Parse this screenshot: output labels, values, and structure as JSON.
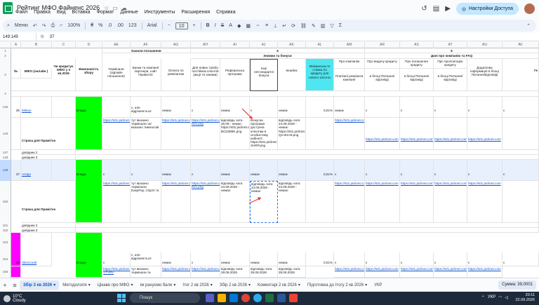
{
  "window": {
    "title": "Рейтинг МФО Файненс 2026",
    "menu": [
      "Файл",
      "Правка",
      "Вид",
      "Вставка",
      "Формат",
      "Данные",
      "Инструменты",
      "Расширения",
      "Справка"
    ],
    "share_label": "Настройки Доступа"
  },
  "toolbar": {
    "menu_label": "Меню",
    "zoom": "100%",
    "currency": "₴",
    "percent": "%",
    "decimals_less": ".0",
    "decimals_more": ".00",
    "number_format": "123",
    "font": "Arial",
    "font_size": "10"
  },
  "formula": {
    "namebox": "149:149",
    "fx": "fx",
    "value": "37"
  },
  "columns": [
    "",
    "A",
    "B",
    "C",
    "D",
    "AE",
    "AF",
    "AG",
    "AH",
    "AI",
    "AJ",
    "AK",
    "AL",
    "AM",
    "AR",
    "AS",
    "AT",
    "AU",
    "AV"
  ],
  "groups": {
    "g1": "Канали погашення",
    "g2": "Знижки та бонуси",
    "g3": "Дані про компанію та FAQ",
    "n5": "5",
    "n6": "6"
  },
  "headers": {
    "num": "№",
    "mfo": "МФО (онлайн )",
    "credits": "Чи кредитує МФО у 3 кв.2026",
    "reqs": "Виконаність зборy",
    "terminals": "Термінали (офлайн погашення)",
    "banks": "Банки та компанії партнери, сайт Приват24",
    "req_pay": "Оплата по реквізитам",
    "new_clients": "Для нових та/або постійних клієнтів (акції та знижки)",
    "referral": "Реферальна програма",
    "other_bonus": "Інші нестандартні бонуси",
    "cashback": "Кешбек",
    "min_rate": "Мінімальна % ставка по кредиту для нового клієнта",
    "about": "Про компанію",
    "payment_req": "Платіжні реквізити компанії",
    "issue": "Про видачу кредиту",
    "repay": "Про погашення кредиту",
    "extend": "Про пролонгацію кредиту",
    "extra": "Додаткова інформація в блоці Питання/відповіді",
    "in_block1": "в блоці Питання/відповіді",
    "in_block2": "в блоці Питання/відповіді",
    "in_block3": "в блоці Питання/відповіді",
    "cut": "Ге"
  },
  "rows": {
    "r1": "1",
    "r2": "2",
    "r3": "3",
    "r4": "4",
    "r145": "145",
    "r146": "146",
    "r147": "147",
    "r148": "148",
    "r149": "149",
    "r150": "150",
    "r151": "151",
    "r152": "152",
    "r153": "153",
    "r154": "154",
    "r155": "155"
  },
  "entries": {
    "n36": "36",
    "milean": "Milean",
    "done1": "Влада",
    "yes": "є",
    "no": "немає",
    "yes_but": "є, але відрізняється",
    "here_terminal": "тут вказано термінали та/ вказано тимчасові",
    "link": "https://s01.piclinet.com",
    "link_png": "https://s01.piclinet.com/i/t-Nzx.png",
    "refer_text": "відповідь чата 26.08 - немає: https://s01.piclinet.com/i/t-BCD389K.png",
    "bonus_text": "Бонусна програма доступна клієнтам в особистому кабінеті: https://s01.piclinet.com/i/t-XHRP.png",
    "chat_24": "відповідь чата 24.08.2026 - немає: https://s01.piclinet.com/i/t-QU B1A8.png",
    "pct": "0,01%",
    "row_label": "Строка для Приміток",
    "dovidnik2": "довідник 2",
    "dovidnik3": "довідник 3",
    "n37": "37",
    "amigo": "Amigo",
    "here_terminal2": "тут вказано термінали EasyPay, City24 та",
    "chat_24b": "відповідь чата 24.08.2026 - немає:",
    "n38": "38",
    "skincredit": "SkinCredit",
    "link_a": "https://s01.piclinet.com/i/t-VTVRV",
    "here_privat": "тут вказано термінали та",
    "chat_28": "відповідь чата 28.08.2026"
  },
  "sheets": {
    "tabs": [
      "Збір 3 кв 2026",
      "Методологія",
      "Цікаве про МФО",
      "як рахуємо бали",
      "Ітог 2 кв 2026",
      "Збір 2 кв 2026",
      "Коментарі 2 кв 2026",
      "Підготовка до Ітогу 2 кв 2026",
      "УКР"
    ],
    "sum": "Сумма: 39,0001"
  },
  "taskbar": {
    "temp": "10°C",
    "weather": "Cloudy",
    "search": "Пошук",
    "time": "20:11",
    "date": "22.09.2026",
    "lang": "УКР"
  },
  "colors": {
    "green": "#00ff00",
    "cyan": "#4fe6f0",
    "magenta": "#ff00ff",
    "link": "#1155cc",
    "accent": "#0b57d0"
  }
}
